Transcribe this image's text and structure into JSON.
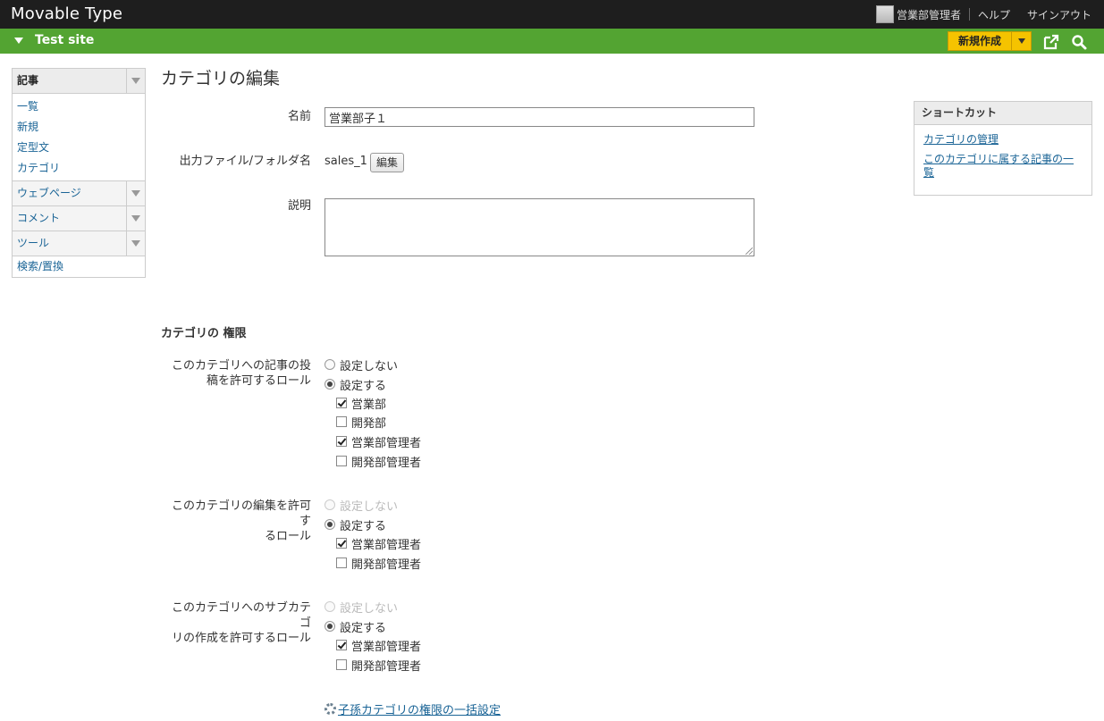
{
  "app": {
    "brand": "Movable Type",
    "user_name": "営業部管理者",
    "help": "ヘルプ",
    "signout": "サインアウト"
  },
  "site": {
    "name": "Test site",
    "new_button": "新規作成"
  },
  "sidebar": {
    "entry_menu": "記事",
    "entry_items": [
      "一覧",
      "新規",
      "定型文",
      "カテゴリ"
    ],
    "webpage_menu": "ウェブページ",
    "comment_menu": "コメント",
    "tools_menu": "ツール",
    "search_replace": "検索/置換"
  },
  "page": {
    "title": "カテゴリの編集"
  },
  "form": {
    "name_label": "名前",
    "name_value": "営業部子１",
    "basename_label": "出力ファイル/フォルダ名",
    "basename_value": "sales_1",
    "edit_button": "編集",
    "description_label": "説明",
    "description_value": ""
  },
  "permissions": {
    "section_title": "カテゴリの 権限",
    "post": {
      "label_line1": "このカテゴリへの記事の投",
      "label_line2": "稿を許可するロール",
      "radio_none": "設定しない",
      "radio_set": "設定する",
      "roles": [
        {
          "label": "営業部",
          "checked": true
        },
        {
          "label": "開発部",
          "checked": false
        },
        {
          "label": "営業部管理者",
          "checked": true
        },
        {
          "label": "開発部管理者",
          "checked": false
        }
      ]
    },
    "edit": {
      "label_line1": "このカテゴリの編集を許可す",
      "label_line2": "るロール",
      "radio_none": "設定しない",
      "radio_set": "設定する",
      "roles": [
        {
          "label": "営業部管理者",
          "checked": true
        },
        {
          "label": "開発部管理者",
          "checked": false
        }
      ]
    },
    "subcategory": {
      "label_line1": "このカテゴリへのサブカテゴ",
      "label_line2": "リの作成を許可するロール",
      "radio_none": "設定しない",
      "radio_set": "設定する",
      "roles": [
        {
          "label": "営業部管理者",
          "checked": true
        },
        {
          "label": "開発部管理者",
          "checked": false
        }
      ]
    },
    "bulk_link": "子孫カテゴリの権限の一括設定"
  },
  "shortcuts": {
    "title": "ショートカット",
    "links": [
      "カテゴリの管理",
      "このカテゴリに属する記事の一覧"
    ]
  }
}
